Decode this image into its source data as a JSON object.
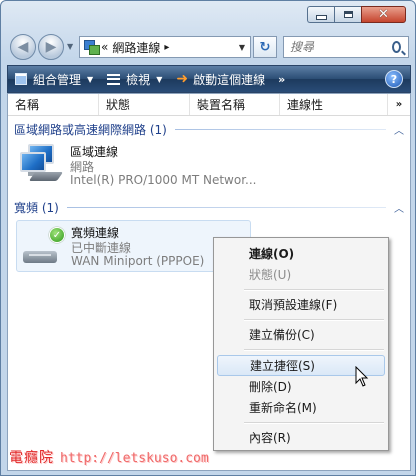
{
  "window": {
    "caption_buttons": [
      "minimize",
      "maximize",
      "close"
    ]
  },
  "address_bar": {
    "prefix": "«",
    "path": "網路連線",
    "separator": "▸",
    "search_placeholder": "搜尋"
  },
  "toolbar": {
    "organize": "組合管理",
    "views": "檢視",
    "start_connection": "啟動這個連線",
    "more": "»",
    "help": "?"
  },
  "columns": {
    "name": "名稱",
    "status": "狀態",
    "device_name": "裝置名稱",
    "connectivity": "連線性",
    "more": "»"
  },
  "groups": [
    {
      "title": "區域網路或高速網際網路 (1)",
      "items": [
        {
          "name": "區域連線",
          "status": "網路",
          "device": "Intel(R) PRO/1000 MT Networ..."
        }
      ]
    },
    {
      "title": "寬頻 (1)",
      "items": [
        {
          "name": "寬頻連線",
          "status": "已中斷連線",
          "device": "WAN Miniport (PPPOE)"
        }
      ]
    }
  ],
  "context_menu": {
    "items": [
      {
        "label": "連線(O)",
        "bold": true
      },
      {
        "label": "狀態(U)",
        "disabled": true
      },
      {
        "label": "取消預設連線(F)"
      },
      {
        "label": "建立備份(C)"
      },
      {
        "label": "建立捷徑(S)",
        "hover": true
      },
      {
        "label": "刪除(D)"
      },
      {
        "label": "重新命名(M)"
      },
      {
        "label": "內容(R)"
      }
    ]
  },
  "watermark": {
    "brand": "電癮院",
    "url": "http://letskuso.com"
  },
  "colors": {
    "toolbar": "#2b4d74",
    "group_header": "#1e3f8a",
    "menu_hover": "#dae8f7"
  }
}
